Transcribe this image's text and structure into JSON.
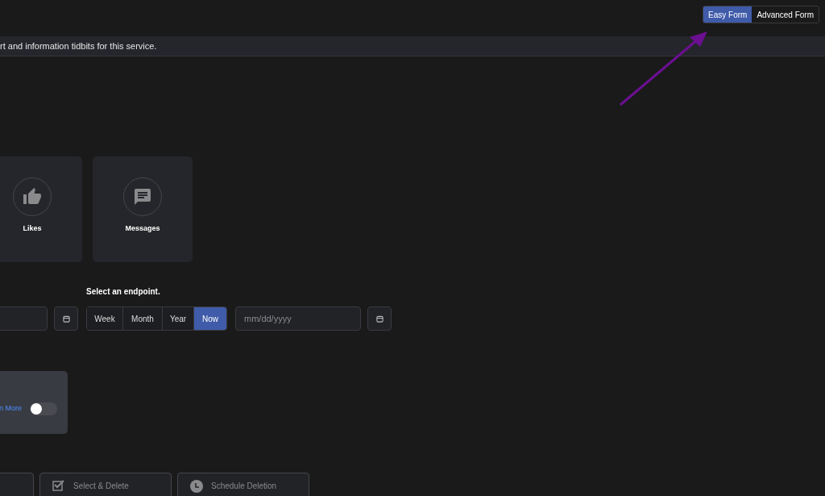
{
  "mode_toggle": [
    {
      "label": "Easy Form",
      "selected": true
    },
    {
      "label": "Advanced Form",
      "selected": false
    }
  ],
  "banner": {
    "text": "rt and information tidbits for this service."
  },
  "categories": [
    {
      "label": "Likes",
      "kind": "likes"
    },
    {
      "label": "Messages",
      "kind": "messages"
    }
  ],
  "endpoint": {
    "label": "Select an endpoint.",
    "ranges": [
      {
        "label": "Week",
        "selected": false
      },
      {
        "label": "Month",
        "selected": false
      },
      {
        "label": "Year",
        "selected": false
      },
      {
        "label": "Now",
        "selected": true
      }
    ],
    "date_placeholder": "mm/dd/yyyy"
  },
  "option_card": {
    "link": "n More",
    "on": false
  },
  "actions": [
    {
      "kind": "plain"
    },
    {
      "label": "Select & Delete",
      "kind": "select"
    },
    {
      "label": "Schedule Deletion",
      "kind": "schedule"
    }
  ]
}
